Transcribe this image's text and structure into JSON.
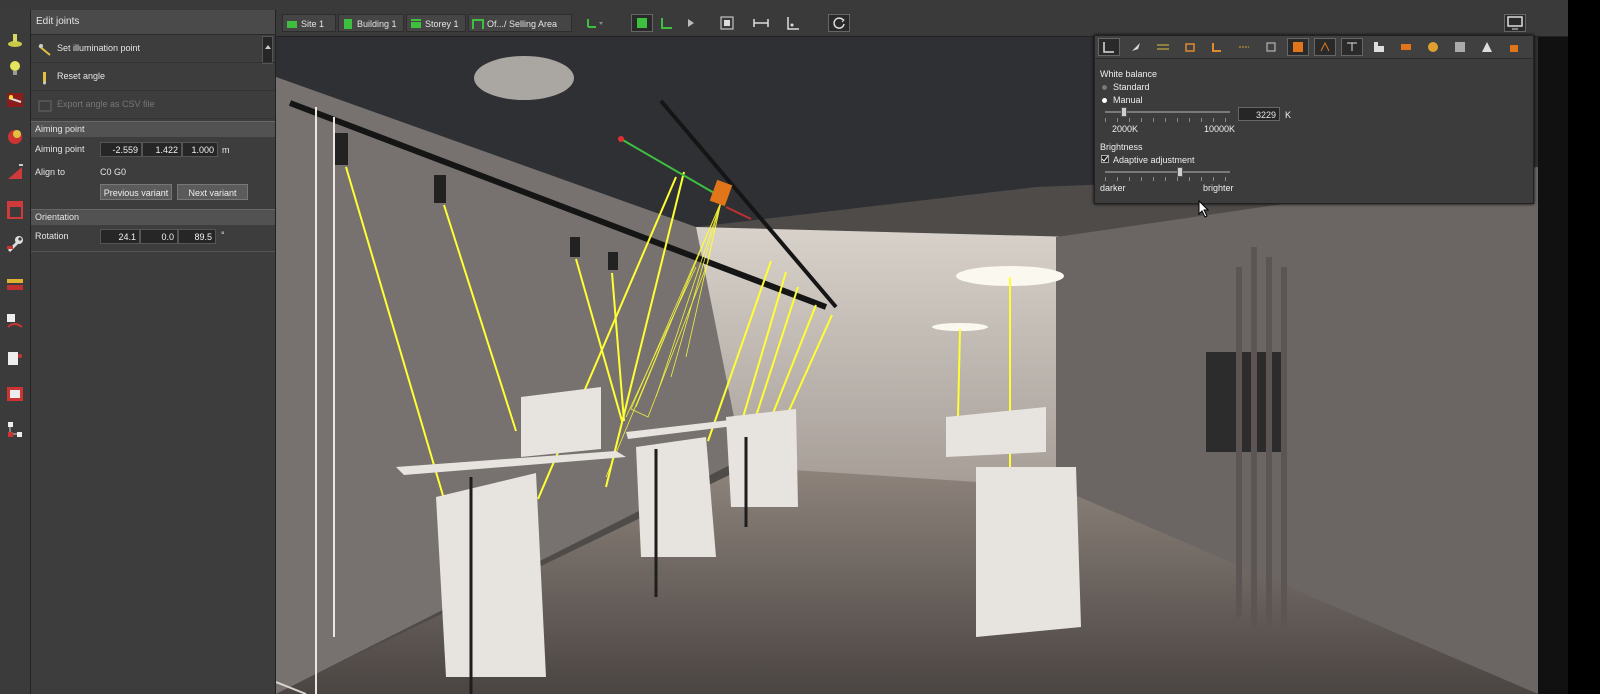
{
  "left_panel": {
    "title": "Edit joints",
    "joints": [
      {
        "label": "Set illumination point",
        "icon": "illumination-point-icon",
        "enabled": true
      },
      {
        "label": "Reset angle",
        "icon": "reset-angle-icon",
        "enabled": true
      },
      {
        "label": "Export angle as CSV file",
        "icon": "export-csv-icon",
        "enabled": false
      }
    ],
    "aiming_point": {
      "section": "Aiming point",
      "label": "Aiming point",
      "x": "-2.559",
      "y": "1.422",
      "z": "1.000",
      "unit": "m",
      "align_label": "Align to",
      "align_value": "C0  G0",
      "prev_button": "Previous variant",
      "next_button": "Next variant"
    },
    "orientation": {
      "section": "Orientation",
      "label": "Rotation",
      "values": [
        "24.1",
        "0.0",
        "89.5"
      ],
      "unit": "°"
    }
  },
  "toolbar": {
    "breadcrumbs": [
      {
        "label": "Site 1",
        "icon": "site-icon"
      },
      {
        "label": "Building 1",
        "icon": "building-icon"
      },
      {
        "label": "Storey 1",
        "icon": "storey-icon"
      },
      {
        "label": "Of.../ Selling Area",
        "icon": "room-icon"
      }
    ]
  },
  "white_balance": {
    "title": "White balance",
    "options": [
      "Standard",
      "Manual"
    ],
    "selected": "Manual",
    "kelvin_value": "3229",
    "kelvin_unit": "K",
    "min_label": "2000K",
    "max_label": "10000K",
    "slider_level": 0.15,
    "brightness_title": "Brightness",
    "adaptive_label": "Adaptive adjustment",
    "adaptive_checked": true,
    "darker_label": "darker",
    "brighter_label": "brighter",
    "brightness_level": 0.6
  },
  "colors": {
    "panel_bg": "#3d3d3d",
    "accent_orange": "#e0751a",
    "accent_green": "#3fbf3f",
    "beam_yellow": "#ffff33"
  }
}
